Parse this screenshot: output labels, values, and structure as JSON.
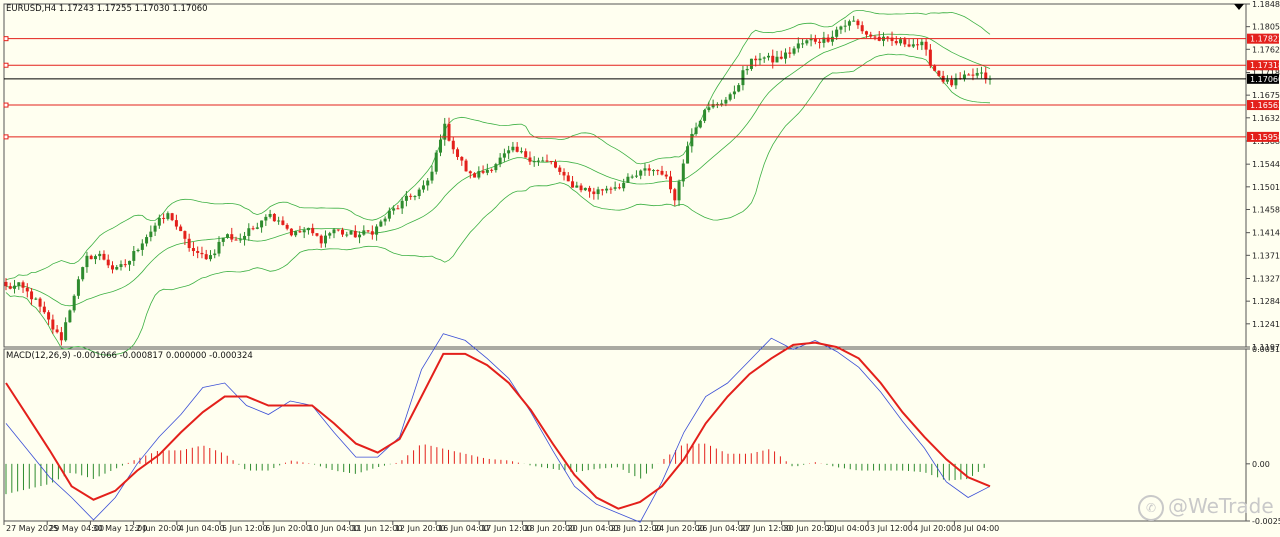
{
  "symbol_header": "EURUSD,H4  1.17243 1.17255 1.17030 1.17060",
  "macd_header": "MACD(12,26,9) -0.001066 -0.000817 0.000000 -0.000324",
  "watermark": "@WeTrade",
  "colors": {
    "background": "#fffff0",
    "bull": "#2e8b2e",
    "bear": "#e3201b",
    "bands": "#3cb043",
    "hline": "#e3201b",
    "macd_line": "#3b4fd6",
    "signal_line": "#e3201b",
    "current_price_tag": "#000000",
    "level_tag": "#e3201b"
  },
  "chart_data": [
    {
      "type": "candlestick",
      "title": "EURUSD,H4",
      "indicators": [
        "Bollinger Bands"
      ],
      "ylim": [
        1.1197,
        1.1848
      ],
      "y_ticks": [
        "1.18480",
        "1.18050",
        "1.17620",
        "1.17180",
        "1.16750",
        "1.16320",
        "1.15880",
        "1.15440",
        "1.15010",
        "1.14580",
        "1.14140",
        "1.13710",
        "1.13270",
        "1.12840",
        "1.12410",
        "1.11970"
      ],
      "x_ticks": [
        "27 May 2025",
        "29 May 04:00",
        "30 May 12:00",
        "2 Jun 20:00",
        "4 Jun 04:00",
        "5 Jun 12:00",
        "6 Jun 20:00",
        "10 Jun 04:00",
        "11 Jun 12:00",
        "12 Jun 20:00",
        "16 Jun 04:00",
        "17 Jun 12:00",
        "18 Jun 20:00",
        "20 Jun 04:00",
        "23 Jun 12:00",
        "24 Jun 20:00",
        "26 Jun 04:00",
        "27 Jun 12:00",
        "30 Jun 20:00",
        "2 Jul 04:00",
        "3 Jul 12:00",
        "4 Jul 20:00",
        "8 Jul 04:00"
      ],
      "horizontal_levels": [
        {
          "price": 1.17822,
          "label": "1.17822"
        },
        {
          "price": 1.17318,
          "label": "1.17318"
        },
        {
          "price": 1.16562,
          "label": "1.16562"
        },
        {
          "price": 1.15958,
          "label": "1.15958"
        }
      ],
      "current_price": {
        "price": 1.1706,
        "label": "1.17060"
      },
      "price_path": [
        1.131,
        1.1312,
        1.129,
        1.125,
        1.121,
        1.13,
        1.137,
        1.137,
        1.134,
        1.136,
        1.14,
        1.143,
        1.145,
        1.14,
        1.137,
        1.137,
        1.141,
        1.14,
        1.142,
        1.145,
        1.144,
        1.141,
        1.142,
        1.14,
        1.142,
        1.141,
        1.141,
        1.142,
        1.145,
        1.147,
        1.149,
        1.151,
        1.162,
        1.156,
        1.152,
        1.153,
        1.155,
        1.157,
        1.156,
        1.155,
        1.1545,
        1.151,
        1.15,
        1.149,
        1.15,
        1.1505,
        1.152,
        1.1535,
        1.153,
        1.148,
        1.16,
        1.164,
        1.166,
        1.167,
        1.172,
        1.175,
        1.174,
        1.175,
        1.177,
        1.178,
        1.178,
        1.1805,
        1.1815,
        1.179,
        1.178,
        1.1775,
        1.1775,
        1.177,
        1.172,
        1.1695,
        1.1705,
        1.1715,
        1.1706
      ]
    },
    {
      "type": "line",
      "title": "MACD(12,26,9)",
      "series": [
        {
          "name": "MACD",
          "values": [
            0.0018,
            0.0006,
            -0.0006,
            -0.0015,
            -0.0025,
            -0.0015,
            0.0,
            0.0012,
            0.0022,
            0.0034,
            0.0036,
            0.0026,
            0.0022,
            0.0028,
            0.0026,
            0.0014,
            0.0003,
            0.0003,
            0.0012,
            0.0042,
            0.0058,
            0.0055,
            0.0047,
            0.0038,
            0.0023,
            0.0006,
            -0.001,
            -0.0018,
            -0.0022,
            -0.0026,
            -0.0008,
            0.0014,
            0.003,
            0.0036,
            0.0046,
            0.0056,
            0.0051,
            0.0055,
            0.005,
            0.0043,
            0.0032,
            0.0019,
            0.0007,
            -0.0008,
            -0.0015,
            -0.001
          ]
        },
        {
          "name": "Signal",
          "values": [
            0.0036,
            0.0021,
            0.0006,
            -0.001,
            -0.0016,
            -0.0012,
            -0.0003,
            0.0004,
            0.0014,
            0.0023,
            0.003,
            0.003,
            0.0026,
            0.0026,
            0.0026,
            0.0018,
            0.0009,
            0.0005,
            0.0011,
            0.003,
            0.0049,
            0.0049,
            0.0044,
            0.0036,
            0.0024,
            0.0009,
            -0.0005,
            -0.0015,
            -0.002,
            -0.0017,
            -0.001,
            0.0002,
            0.0018,
            0.003,
            0.004,
            0.0047,
            0.0053,
            0.0054,
            0.0052,
            0.0047,
            0.0036,
            0.0023,
            0.0012,
            0.0002,
            -0.0006,
            -0.001
          ]
        }
      ],
      "y_ticks": [
        "0.005117",
        "0.00",
        "-0.002548"
      ],
      "ylim": [
        -0.002548,
        0.005117
      ]
    }
  ]
}
